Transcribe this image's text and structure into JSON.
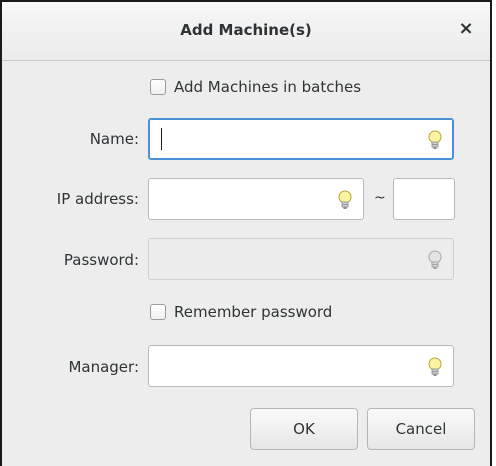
{
  "window": {
    "title": "Add Machine(s)",
    "close_label": "×"
  },
  "form": {
    "batch_checkbox": {
      "label": "Add Machines in batches",
      "checked": false
    },
    "name": {
      "label": "Name:",
      "value": "",
      "focused": true
    },
    "ip_address": {
      "label": "IP address:",
      "value": "",
      "range_separator": "~",
      "range_end_value": ""
    },
    "password": {
      "label": "Password:",
      "value": "",
      "enabled": false
    },
    "remember_checkbox": {
      "label": "Remember password",
      "checked": false
    },
    "manager": {
      "label": "Manager:",
      "value": ""
    }
  },
  "buttons": {
    "ok": "OK",
    "cancel": "Cancel"
  },
  "icons": {
    "entry_hint": "lightbulb-icon"
  }
}
